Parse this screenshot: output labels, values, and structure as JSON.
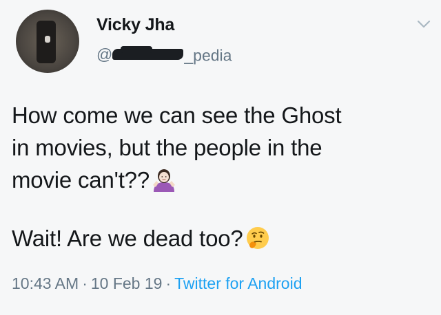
{
  "author": {
    "name": "Vicky Jha",
    "handle_prefix": "@",
    "handle_suffix": "_pedia"
  },
  "tweet": {
    "line1": "How come we can see the Ghost",
    "line2": "in movies, but the people in the",
    "line3": "movie can't??",
    "line4": "Wait! Are we dead too?",
    "emoji1": "person-shrugging-emoji",
    "emoji2": "thinking-face-emoji"
  },
  "meta": {
    "time": "10:43 AM",
    "separator": "·",
    "date": "10 Feb 19",
    "source": "Twitter for Android"
  },
  "colors": {
    "text": "#14171a",
    "secondary": "#657786",
    "link": "#1da1f2",
    "background": "#f6f7f8"
  },
  "icons": {
    "menu": "chevron-down-icon"
  }
}
